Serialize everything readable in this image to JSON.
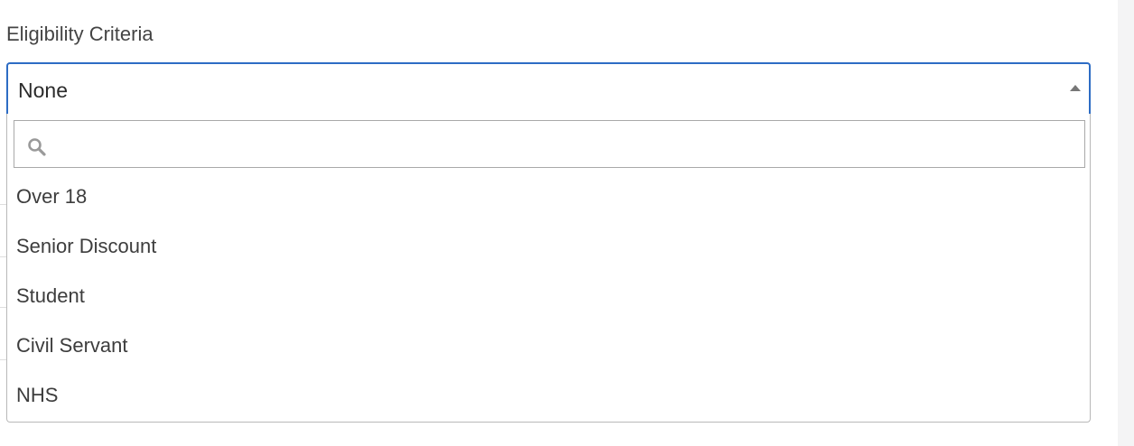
{
  "field": {
    "label": "Eligibility Criteria",
    "selected_value": "None"
  },
  "search": {
    "value": "",
    "placeholder": ""
  },
  "options": [
    {
      "label": "Over 18"
    },
    {
      "label": "Senior Discount"
    },
    {
      "label": "Student"
    },
    {
      "label": "Civil Servant"
    },
    {
      "label": "NHS"
    }
  ],
  "colors": {
    "focus_border": "#2d6cc4",
    "text": "#3d3d3d",
    "dropdown_border": "#b8b8b8"
  },
  "icons": {
    "dropdown_toggle": "triangle-up-icon",
    "search": "search-icon"
  }
}
